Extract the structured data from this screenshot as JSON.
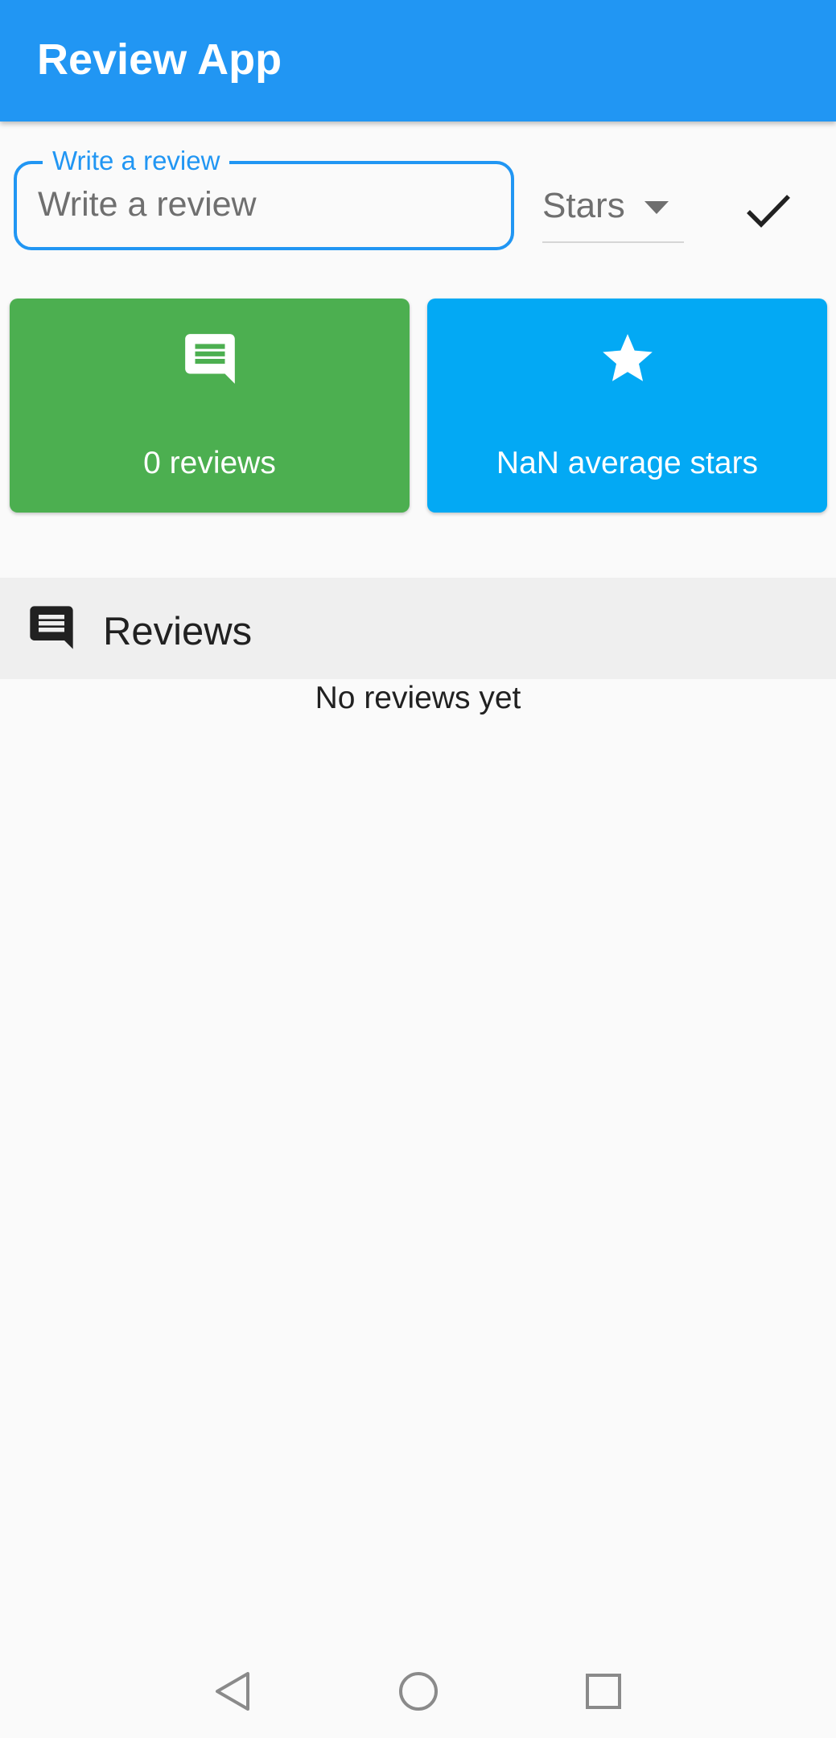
{
  "app_bar": {
    "title": "Review App"
  },
  "review_form": {
    "label": "Write a review",
    "placeholder": "Write a review",
    "value": "",
    "stars_dropdown": {
      "selected": "Stars"
    }
  },
  "stats": {
    "reviews_count": "0 reviews",
    "average_stars": "NaN average stars",
    "reviews_color": "#4caf50",
    "stars_color": "#03a9f4"
  },
  "reviews_section": {
    "title": "Reviews",
    "empty_message": "No reviews yet"
  },
  "theme": {
    "primary": "#2196f3"
  },
  "icons": {
    "card_reviews": "comment-icon",
    "card_stars": "star-icon",
    "submit": "check-icon",
    "section": "comment-icon",
    "nav_back": "back-triangle-icon",
    "nav_home": "home-circle-icon",
    "nav_recents": "recents-square-icon"
  }
}
